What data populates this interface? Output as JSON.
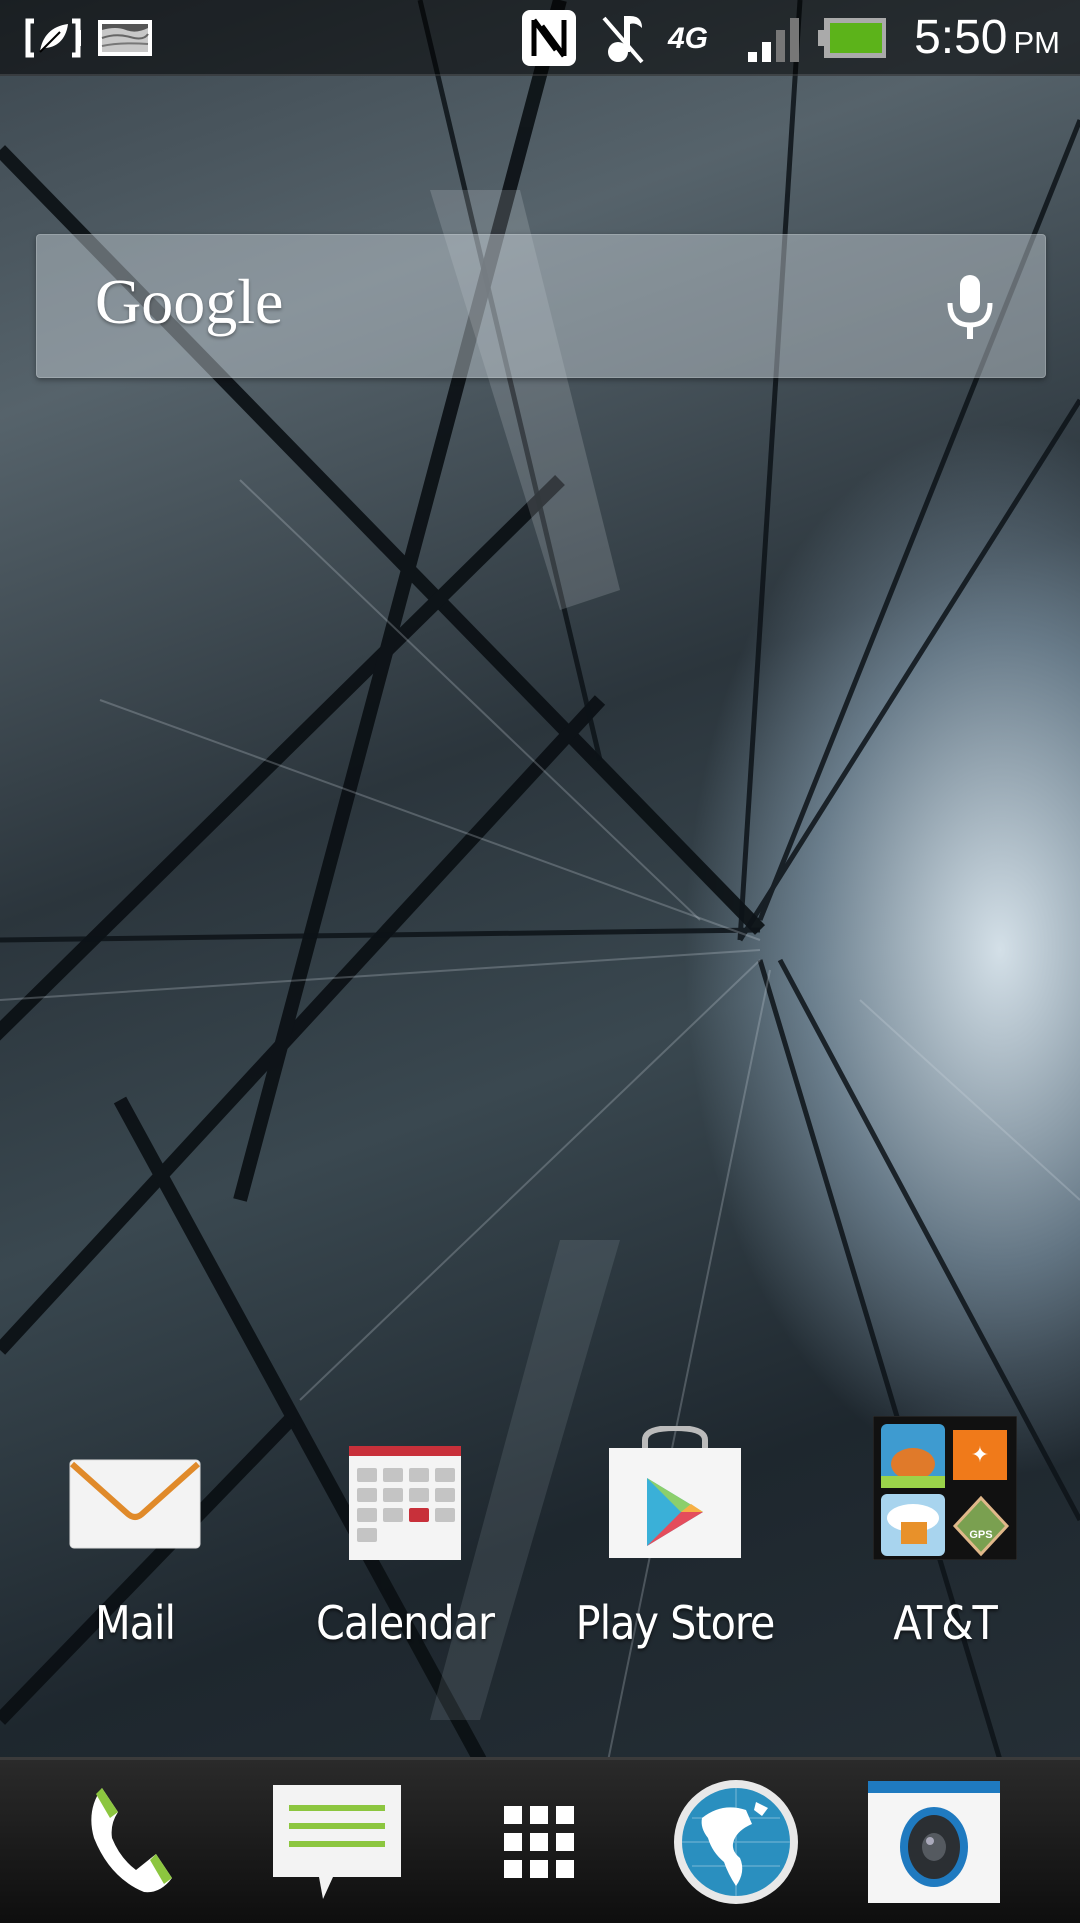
{
  "status_bar": {
    "left_icons": [
      "power-saver-icon",
      "gallery-notification-icon"
    ],
    "right_icons": [
      "nfc-icon",
      "music-muted-icon",
      "network-4g-icon",
      "signal-strength-icon",
      "battery-icon"
    ],
    "network_type": "4G",
    "signal_bars": 2,
    "signal_bars_total": 4,
    "battery_level": 1.0,
    "battery_color": "#5cb31a",
    "time": "5:50",
    "ampm": "PM"
  },
  "search_widget": {
    "logo_text": "Google",
    "voice_icon": "microphone-icon"
  },
  "home_apps": [
    {
      "label": "Mail",
      "icon": "mail-icon"
    },
    {
      "label": "Calendar",
      "icon": "calendar-icon"
    },
    {
      "label": "Play Store",
      "icon": "play-store-icon"
    },
    {
      "label": "AT&T",
      "icon": "att-folder-icon"
    }
  ],
  "dock": [
    {
      "name": "phone",
      "icon": "phone-icon"
    },
    {
      "name": "messages",
      "icon": "messages-icon"
    },
    {
      "name": "all-apps",
      "icon": "app-drawer-icon"
    },
    {
      "name": "browser",
      "icon": "globe-icon"
    },
    {
      "name": "camera",
      "icon": "camera-icon"
    }
  ],
  "colors": {
    "accent_green": "#8cc63f",
    "calendar_red": "#c8303a",
    "mail_orange": "#e08a2a",
    "globe_blue": "#2a8fbf",
    "camera_blue": "#1f7ac0"
  }
}
